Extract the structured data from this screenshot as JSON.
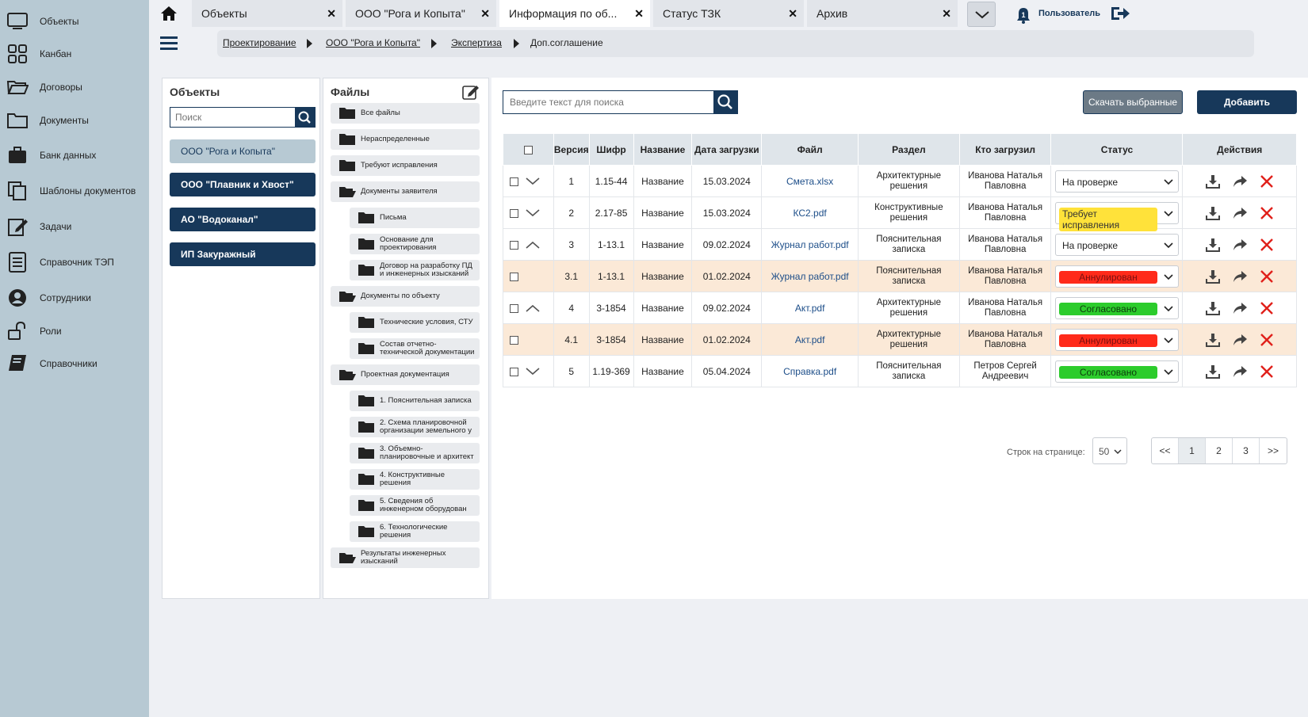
{
  "sidebar": {
    "items": [
      {
        "label": "Объекты",
        "icon": "monitor-icon"
      },
      {
        "label": "Канбан",
        "icon": "kanban-icon"
      },
      {
        "label": "Договоры",
        "icon": "folder-open-icon"
      },
      {
        "label": "Документы",
        "icon": "folder-icon"
      },
      {
        "label": "Банк данных",
        "icon": "briefcase-icon"
      },
      {
        "label": "Шаблоны документов",
        "icon": "copy-icon"
      },
      {
        "label": "Задачи",
        "icon": "edit-icon"
      },
      {
        "label": "Справочник ТЭП",
        "icon": "list-icon"
      },
      {
        "label": "Сотрудники",
        "icon": "user-icon"
      },
      {
        "label": "Роли",
        "icon": "unlock-icon"
      },
      {
        "label": "Справочники",
        "icon": "book-icon"
      }
    ]
  },
  "tabs": [
    {
      "label": "Объекты"
    },
    {
      "label": "ООО \"Рога и Копыта\""
    },
    {
      "label": "Информация по об..."
    },
    {
      "label": "Статус ТЗК"
    },
    {
      "label": "Архив"
    }
  ],
  "user": {
    "label": "Пользователь",
    "notifications": "1"
  },
  "breadcrumb": [
    "Проектирование",
    "ООО \"Рога и Копыта\"",
    "Экспертиза",
    "Доп.соглашение"
  ],
  "objects_panel": {
    "title": "Объекты",
    "search_placeholder": "Поиск",
    "items": [
      "ООО \"Рога и Копыта\"",
      "ООО \"Плавник и Хвост\"",
      "АО \"Водоканал\"",
      "ИП Закуражный"
    ]
  },
  "files_panel": {
    "title": "Файлы",
    "items": [
      {
        "label": "Все файлы"
      },
      {
        "label": "Нераспределенные"
      },
      {
        "label": "Требуют исправления"
      },
      {
        "label": "Документы заявителя"
      },
      {
        "label": "Письма"
      },
      {
        "label": "Основание для проектирования"
      },
      {
        "label": "Договор на разработку ПД и инженерных изысканий"
      },
      {
        "label": "Документы по объекту"
      },
      {
        "label": "Технические условия, СТУ"
      },
      {
        "label": "Состав отчетно-технической документации"
      },
      {
        "label": "Проектная документация"
      },
      {
        "label": "1. Пояснительная записка"
      },
      {
        "label": "2. Схема планировочной организации земельного у"
      },
      {
        "label": "3. Объемно-планировочные и архитект"
      },
      {
        "label": "4. Конструктивные решения"
      },
      {
        "label": "5. Сведения об инженерном оборудован"
      },
      {
        "label": "6. Технологические решения"
      },
      {
        "label": "Результаты инженерных изысканий"
      }
    ]
  },
  "main": {
    "search_placeholder": "Введите текст для поиска",
    "download_selected": "Скачать выбранные",
    "add": "Добавить",
    "columns": [
      "Версия",
      "Шифр",
      "Название",
      "Дата загрузки",
      "Файл",
      "Раздел",
      "Кто загрузил",
      "Статус",
      "Действия"
    ],
    "rows": [
      {
        "version": "1",
        "code": "1.15-44",
        "name": "Название",
        "date": "15.03.2024",
        "file": "Смета.xlsx",
        "section": "Архитектурные решения",
        "uploader": "Иванова Наталья Павловна",
        "status": "На проверке",
        "status_kind": "plain",
        "toggle": "down"
      },
      {
        "version": "2",
        "code": "2.17-85",
        "name": "Название",
        "date": "15.03.2024",
        "file": "КС2.pdf",
        "section": "Конструктивные решения",
        "uploader": "Иванова Наталья Павловна",
        "status": "Требует исправления",
        "status_kind": "yellow",
        "toggle": "down"
      },
      {
        "version": "3",
        "code": "1-13.1",
        "name": "Название",
        "date": "09.02.2024",
        "file": "Журнал работ.pdf",
        "section": "Пояснительная записка",
        "uploader": "Иванова Наталья Павловна",
        "status": "На проверке",
        "status_kind": "plain",
        "toggle": "up"
      },
      {
        "version": "3.1",
        "code": "1-13.1",
        "name": "Название",
        "date": "01.02.2024",
        "file": "Журнал работ.pdf",
        "section": "Пояснительная записка",
        "uploader": "Иванова Наталья Павловна",
        "status": "Аннулирован",
        "status_kind": "red",
        "toggle": "none"
      },
      {
        "version": "4",
        "code": "3-1854",
        "name": "Название",
        "date": "09.02.2024",
        "file": "Акт.pdf",
        "section": "Архитектурные решения",
        "uploader": "Иванова Наталья Павловна",
        "status": "Согласовано",
        "status_kind": "green",
        "toggle": "up"
      },
      {
        "version": "4.1",
        "code": "3-1854",
        "name": "Название",
        "date": "01.02.2024",
        "file": "Акт.pdf",
        "section": "Архитектурные решения",
        "uploader": "Иванова Наталья Павловна",
        "status": "Аннулирован",
        "status_kind": "red",
        "toggle": "none"
      },
      {
        "version": "5",
        "code": "1.19-369",
        "name": "Название",
        "date": "05.04.2024",
        "file": "Справка.pdf",
        "section": "Пояснительная записка",
        "uploader": "Петров Сергей Андреевич",
        "status": "Согласовано",
        "status_kind": "green",
        "toggle": "down"
      }
    ]
  },
  "pagination": {
    "rows_label": "Строк на странице:",
    "rows_value": "50",
    "pages": [
      "<<",
      "1",
      "2",
      "3",
      ">>"
    ],
    "current": "1"
  },
  "colors": {
    "primary": "#17385a",
    "sidebar": "#b7c9d3",
    "status_yellow": "#ffe23a",
    "status_red": "#ff2a1a",
    "status_green": "#2ccc2c",
    "row_highlight": "#fbe9d7",
    "delete_red": "#e0201a"
  }
}
